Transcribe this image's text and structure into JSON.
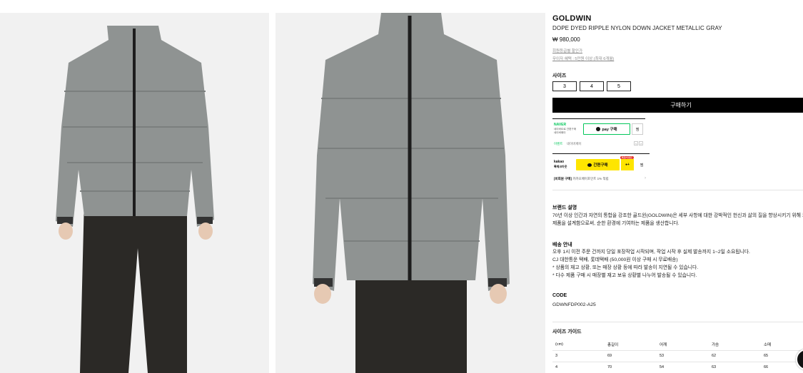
{
  "product": {
    "brand": "GOLDWIN",
    "name": "DOPE DYED RIPPLE NYLON DOWN JACKET METALLIC GRAY",
    "price": "₩ 980,000",
    "member_note": "회원등급별 할인가",
    "installment_note": "무이자 혜택 : 5만원 이상 (최대 6개월)"
  },
  "sizes": {
    "label": "사이즈",
    "options": [
      "3",
      "4",
      "5"
    ]
  },
  "buy_button": "구매하기",
  "naver": {
    "logo": "NAVER",
    "sub_line1": "네이버ID로 간편구매",
    "sub_line2": "네이버페이",
    "pay_label": "pay 구매",
    "zzim_label": "찜",
    "event_label": "이벤트",
    "event_text": "네이버페이"
  },
  "kakao": {
    "logo": "kakao",
    "sub": "톡체크아웃",
    "pay_label": "간편구매",
    "badge": "톡딜/이벤트",
    "zzim_label": "찜",
    "promo_bold": "[비회원 구매]",
    "promo_text": "카카오페이포인트 1% 적립"
  },
  "brand_section": {
    "title": "브랜드 설명",
    "lines": [
      "70년 이상 인간과 자연의 통합을 강조한 골드윈(GOLDWIN)은 세부 사항에 대한 강박적인 헌신과 삶의 질을 향상시키기 위해 모든",
      "제품을 설계함으로써, 순한 환경에 기여하는 제품을 생산합니다."
    ]
  },
  "shipping_section": {
    "title": "배송 안내",
    "lines": [
      "오후 1시 이전 주문 건까지 당일 포장작업 시작되며, 작업 시작 후 실제 발송까지 1~2일 소요됩니다.",
      "CJ 대한통운 택배, 롯데택배 (50,000원 이상 구매 시 무료배송)",
      "* 상품의 재고 상황, 또는 매장 상황 등에 따라 발송이 지연될 수 있습니다.",
      "* 다수 제품 구매 시 매장별 재고 보유 상황별 나누어 발송될 수 있습니다."
    ]
  },
  "code_section": {
    "title": "CODE",
    "value": "GDWNFDP002-A25"
  },
  "size_guide": {
    "title": "사이즈 가이드",
    "headers": [
      "(cm)",
      "총길이",
      "어깨",
      "가슴",
      "소매"
    ],
    "rows": [
      [
        "3",
        "69",
        "53",
        "62",
        "65"
      ],
      [
        "4",
        "70",
        "54",
        "63",
        "66"
      ]
    ]
  },
  "colors": {
    "jacket": "#8f9392",
    "pants": "#2b2926",
    "background_photo": "#f1f1f1",
    "naver_green": "#03c75a",
    "kakao_yellow": "#fee500"
  }
}
